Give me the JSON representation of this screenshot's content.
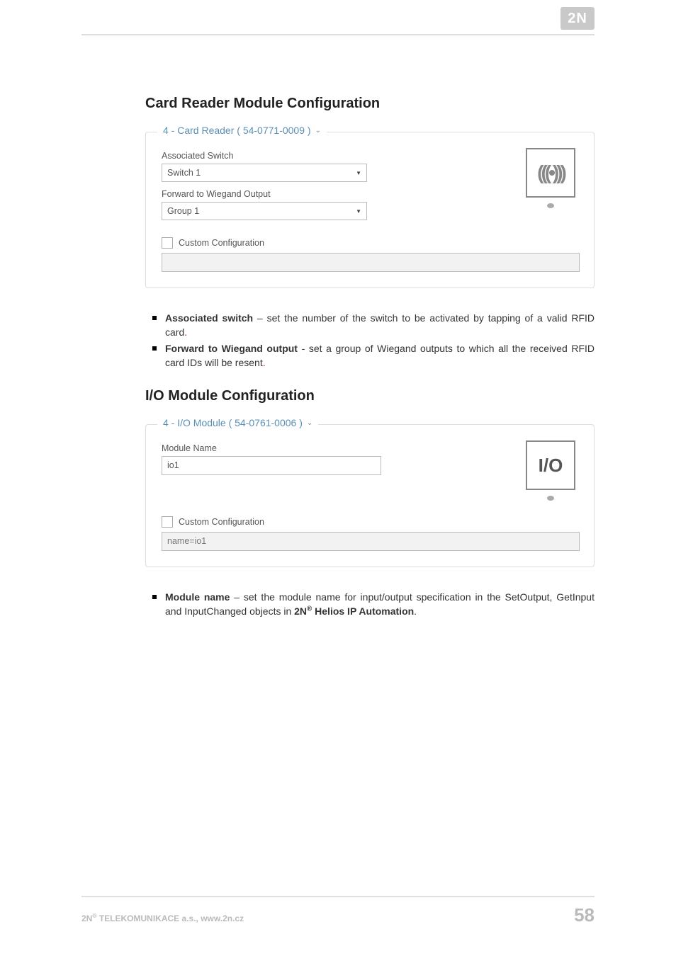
{
  "logo_text": "2N",
  "section1": {
    "title": "Card Reader Module Configuration",
    "legend": "4 - Card Reader ( 54-0771-0009 )",
    "labels": {
      "assoc_switch": "Associated Switch",
      "switch_value": "Switch 1",
      "fwd_wiegand": "Forward to Wiegand Output",
      "group_value": "Group 1",
      "custom_config": "Custom Configuration",
      "custom_value": ""
    },
    "thumb_glyph": "(((•)))"
  },
  "bullets1": [
    {
      "b": "Associated switch",
      "t": " – set the number of the switch to be activated by tapping of a valid RFID card",
      "dot": "."
    },
    {
      "b": "Forward to Wiegand output",
      "t": " - set a group of Wiegand outputs to which all the received RFID card IDs will be resent",
      "dot": "."
    }
  ],
  "section2": {
    "title": "I/O Module Configuration",
    "legend": "4 - I/O Module ( 54-0761-0006 )",
    "labels": {
      "module_name": "Module Name",
      "module_value": "io1",
      "custom_config": "Custom Configuration",
      "custom_value": "name=io1"
    },
    "thumb_glyph": "I/O"
  },
  "bullets2": [
    {
      "b": "Module name",
      "t1": " – set the module name for input/output specification in the SetOutput, GetInput and InputChanged objects in ",
      "b2": "2N",
      "sup": "®",
      "b3": " Helios IP Automation",
      "t2": "."
    }
  ],
  "footer": {
    "left_prefix": "2N",
    "left_sup": "®",
    "left_rest": " TELEKOMUNIKACE a.s., www.2n.cz",
    "page": "58"
  }
}
